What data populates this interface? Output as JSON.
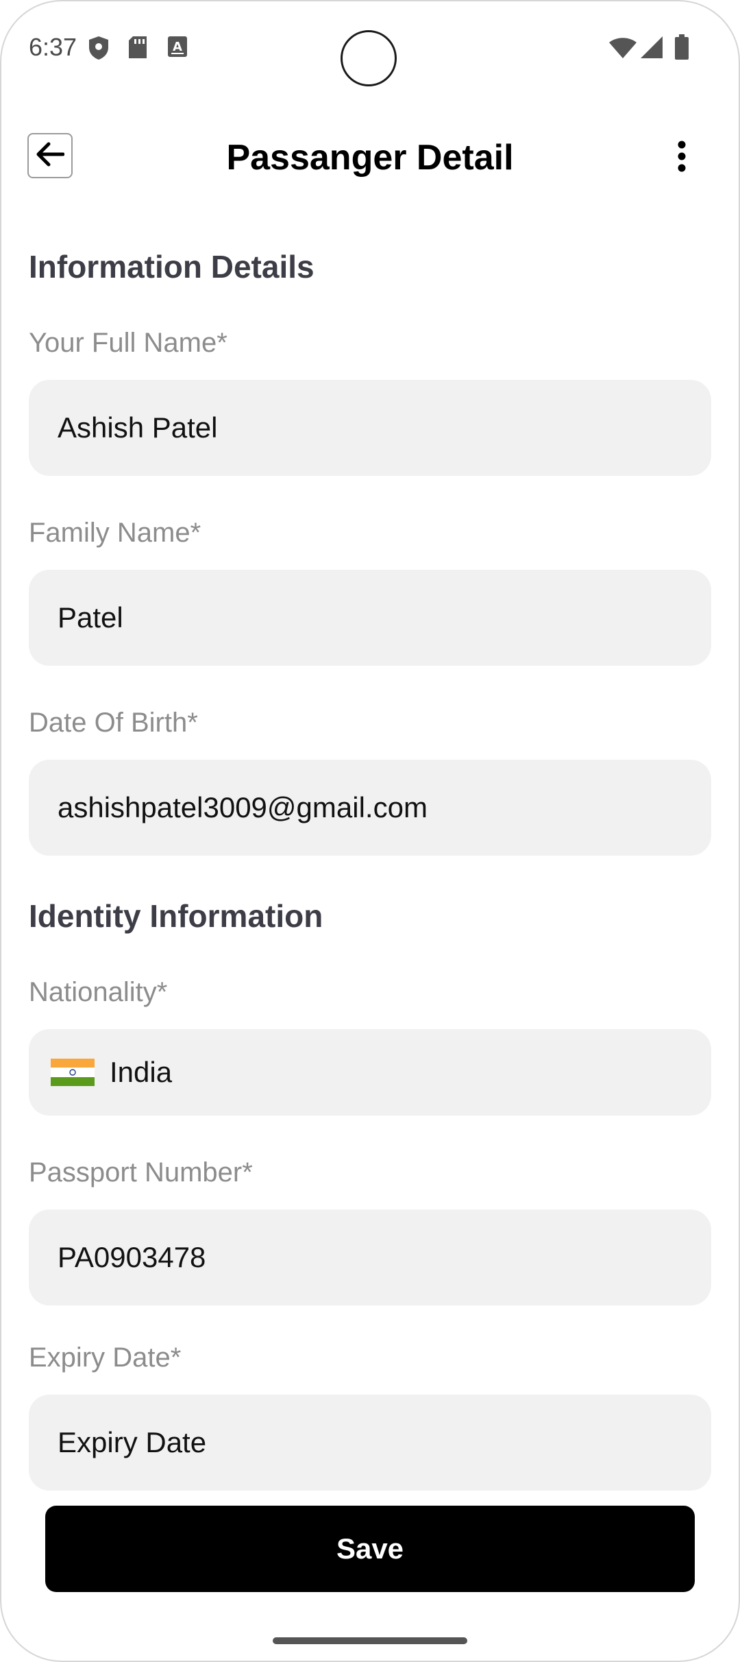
{
  "status_bar": {
    "time": "6:37",
    "left_icons": [
      "shield-icon",
      "sd-card-icon",
      "keyboard-a-icon"
    ],
    "right_icons": [
      "wifi-icon",
      "cell-signal-icon",
      "battery-icon"
    ]
  },
  "app_bar": {
    "title": "Passanger Detail",
    "back_icon": "arrow-left-icon",
    "menu_icon": "more-vertical-icon"
  },
  "sections": {
    "info_heading": "Information Details",
    "identity_heading": "Identity Information"
  },
  "fields": {
    "full_name": {
      "label": "Your Full Name*",
      "value": "Ashish Patel"
    },
    "family_name": {
      "label": "Family Name*",
      "value": "Patel"
    },
    "dob": {
      "label": "Date Of Birth*",
      "value": "ashishpatel3009@gmail.com"
    },
    "nationality": {
      "label": "Nationality*",
      "value": "India",
      "flag_colors": [
        "#F9A63B",
        "#FFFFFF",
        "#5B9B1C"
      ],
      "flag_icon": "india-flag-icon"
    },
    "passport": {
      "label": "Passport Number*",
      "value": "PA0903478"
    },
    "expiry": {
      "label": "Expiry Date*",
      "value": "Expiry Date"
    }
  },
  "actions": {
    "save_label": "Save"
  },
  "colors": {
    "field_bg": "#F1F1F1",
    "label": "#8C8C8C",
    "heading": "#3D3D47",
    "button_bg": "#000000"
  }
}
